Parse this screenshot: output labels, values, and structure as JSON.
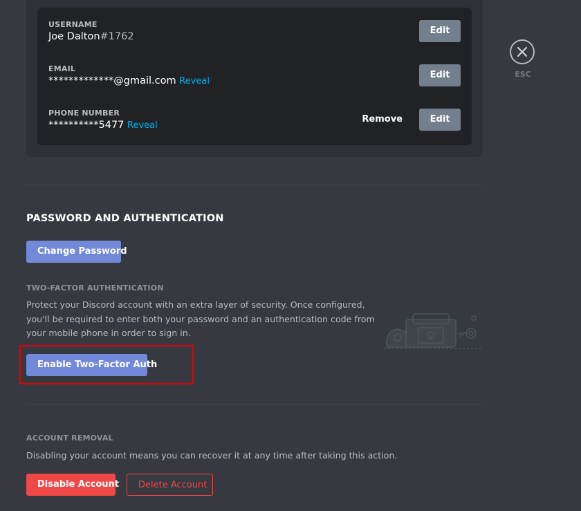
{
  "account": {
    "username": {
      "label": "USERNAME",
      "name": "Joe Dalton",
      "discriminator": "#1762",
      "edit_label": "Edit"
    },
    "email": {
      "label": "EMAIL",
      "value": "*************@gmail.com",
      "reveal_label": "Reveal",
      "edit_label": "Edit"
    },
    "phone": {
      "label": "PHONE NUMBER",
      "value": "**********5477",
      "reveal_label": "Reveal",
      "remove_label": "Remove",
      "edit_label": "Edit"
    }
  },
  "close": {
    "esc_label": "ESC"
  },
  "password_section": {
    "title": "PASSWORD AND AUTHENTICATION",
    "change_password_label": "Change Password",
    "two_factor": {
      "title": "TWO-FACTOR AUTHENTICATION",
      "description": "Protect your Discord account with an extra layer of security. Once configured, you'll be required to enter both your password and an authentication code from your mobile phone in order to sign in.",
      "enable_label": "Enable Two-Factor Auth"
    }
  },
  "account_removal": {
    "title": "ACCOUNT REMOVAL",
    "description": "Disabling your account means you can recover it at any time after taking this action.",
    "disable_label": "Disable Account",
    "delete_label": "Delete Account"
  },
  "colors": {
    "background": "#36393f",
    "primary": "#7289da",
    "danger": "#f04747",
    "link": "#00b0f4",
    "highlight": "#e00000"
  }
}
